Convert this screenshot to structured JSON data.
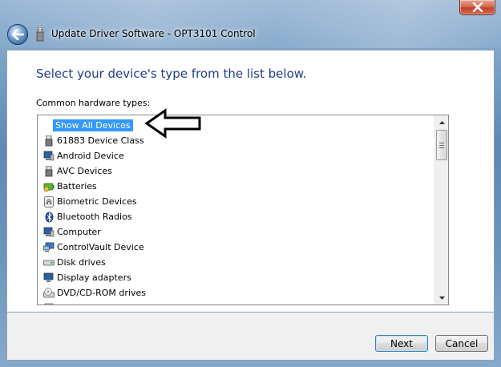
{
  "window": {
    "title": "Update Driver Software - OPT3101 Control"
  },
  "main": {
    "heading": "Select your device's type from the list below.",
    "list_label": "Common hardware types:",
    "items": [
      {
        "label": "Show All Devices",
        "icon": "none",
        "selected": true
      },
      {
        "label": "61883 Device Class",
        "icon": "firewire-plug-icon"
      },
      {
        "label": "Android Device",
        "icon": "computer-monitor-icon"
      },
      {
        "label": "AVC Devices",
        "icon": "firewire-plug-icon"
      },
      {
        "label": "Batteries",
        "icon": "battery-icon"
      },
      {
        "label": "Biometric Devices",
        "icon": "fingerprint-icon"
      },
      {
        "label": "Bluetooth Radios",
        "icon": "bluetooth-icon"
      },
      {
        "label": "Computer",
        "icon": "computer-monitor-icon"
      },
      {
        "label": "ControlVault Device",
        "icon": "network-computer-icon"
      },
      {
        "label": "Disk drives",
        "icon": "disk-drive-icon"
      },
      {
        "label": "Display adapters",
        "icon": "display-adapter-icon"
      },
      {
        "label": "DVD/CD-ROM drives",
        "icon": "optical-drive-icon"
      }
    ]
  },
  "footer": {
    "next_label": "Next",
    "cancel_label": "Cancel"
  },
  "colors": {
    "heading": "#1e3f8a",
    "selection": "#3399ff"
  }
}
